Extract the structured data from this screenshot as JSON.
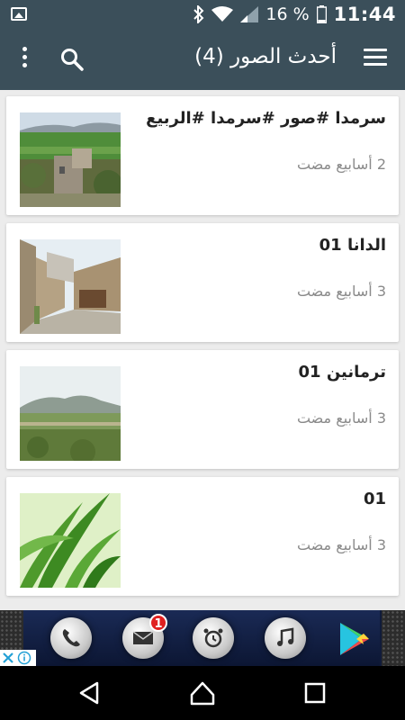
{
  "status_bar": {
    "battery": "16 %",
    "time": "11:44"
  },
  "app_bar": {
    "title": "أحدث الصور (4)"
  },
  "posts": [
    {
      "title": "سرمدا #صور #سرمدا #الربيع",
      "time": "2 أسابيع مضت",
      "thumb": "village-tower"
    },
    {
      "title": "الدانا 01",
      "time": "3 أسابيع مضت",
      "thumb": "alley"
    },
    {
      "title": "ترمانين 01",
      "time": "3 أسابيع مضت",
      "thumb": "hills"
    },
    {
      "title": "01",
      "time": "3 أسابيع مضت",
      "thumb": "green-leaves"
    }
  ],
  "ad": {
    "mail_badge": "1"
  },
  "colors": {
    "app_bar": "#3b4f5a",
    "background": "#ececec",
    "card": "#ffffff",
    "time_text": "#8a8a8a"
  }
}
